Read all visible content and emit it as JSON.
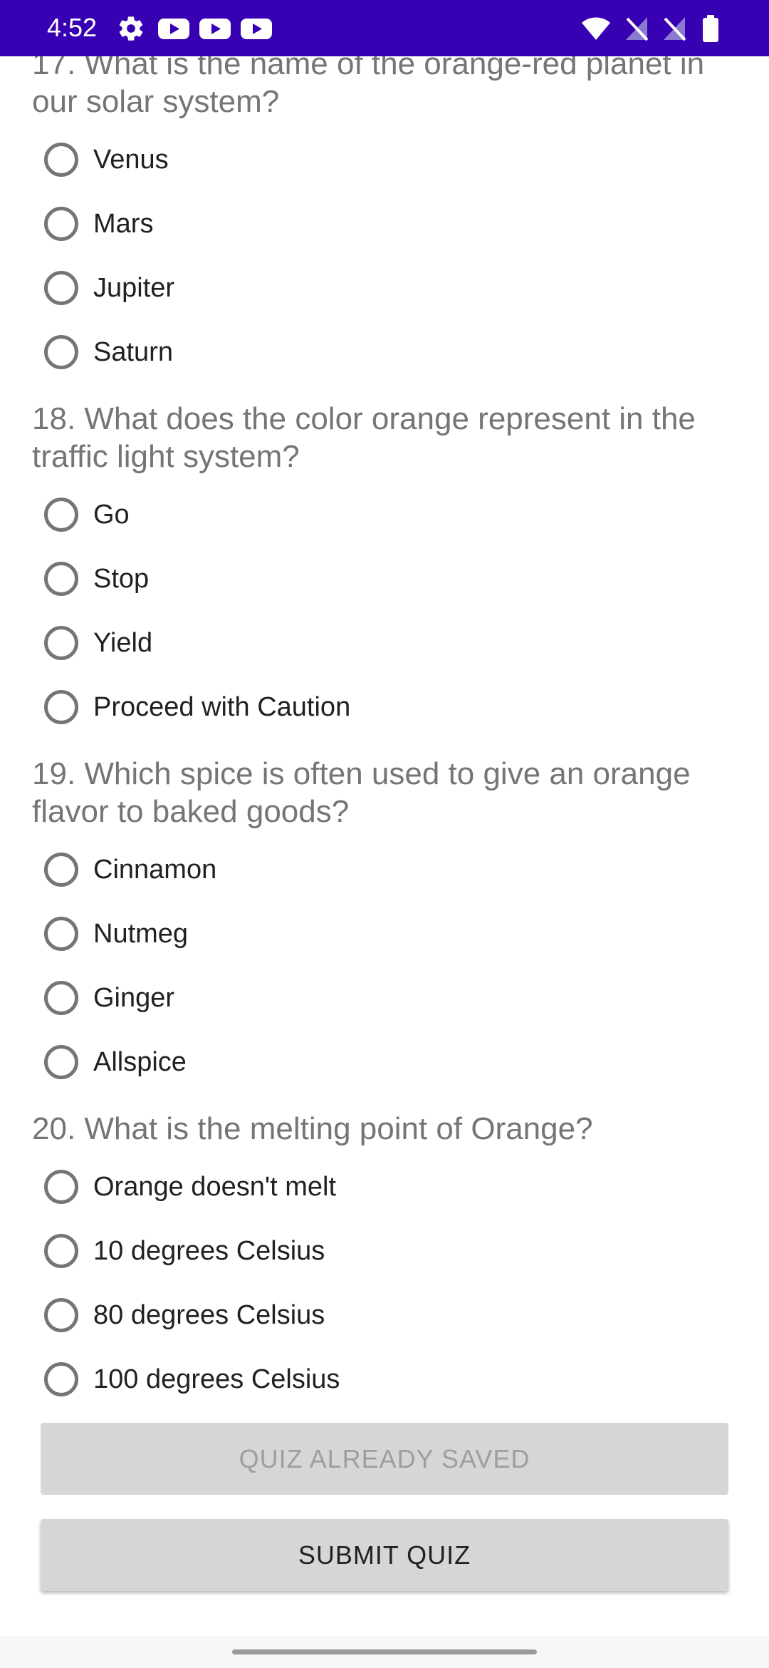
{
  "status_bar": {
    "time": "4:52",
    "background": "#3700b3",
    "left_icons": [
      "gear-icon",
      "youtube-icon",
      "youtube-icon",
      "youtube-icon"
    ],
    "right_icons": [
      "wifi-icon",
      "no-sim-icon",
      "no-sim-icon",
      "battery-icon"
    ]
  },
  "questions": [
    {
      "text": "17. What is the name of the orange-red planet in our solar system?",
      "options": [
        "Venus",
        "Mars",
        "Jupiter",
        "Saturn"
      ]
    },
    {
      "text": "18. What does the color orange represent in the traffic light system?",
      "options": [
        "Go",
        "Stop",
        "Yield",
        "Proceed with Caution"
      ]
    },
    {
      "text": "19. Which spice is often used to give an orange flavor to baked goods?",
      "options": [
        "Cinnamon",
        "Nutmeg",
        "Ginger",
        "Allspice"
      ]
    },
    {
      "text": "20. What is the melting point of Orange?",
      "options": [
        "Orange doesn't melt",
        "10 degrees Celsius",
        "80 degrees Celsius",
        "100 degrees Celsius"
      ]
    }
  ],
  "buttons": {
    "saved_label": "QUIZ ALREADY SAVED",
    "submit_label": "SUBMIT QUIZ"
  }
}
